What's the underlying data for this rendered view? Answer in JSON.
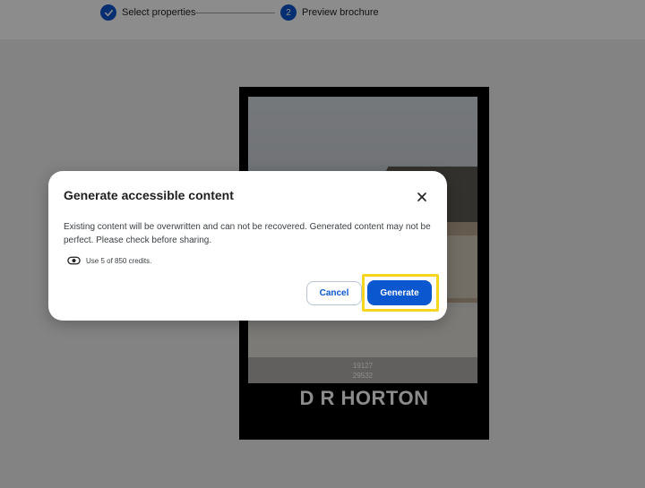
{
  "stepper": {
    "steps": [
      {
        "number": "",
        "label": "Select properties",
        "state": "completed"
      },
      {
        "number": "2",
        "label": "Preview brochure",
        "state": "current"
      }
    ]
  },
  "brochure": {
    "caption_line1": "19127",
    "caption_line2": "29532",
    "brand": "D R HORTON"
  },
  "dialog": {
    "title": "Generate accessible content",
    "body": "Existing content will be overwritten and can not be recovered. Generated content may not be perfect. Please check before sharing.",
    "credits_text": "Use 5 of 850 credits.",
    "cancel_label": "Cancel",
    "generate_label": "Generate"
  },
  "colors": {
    "primary": "#0b57d0",
    "highlight": "#f6d51d",
    "scrim": "rgba(0,0,0,0.45)"
  },
  "icons": {
    "step1": "check-icon",
    "close": "close-icon",
    "credits": "credits-toggle-icon"
  }
}
